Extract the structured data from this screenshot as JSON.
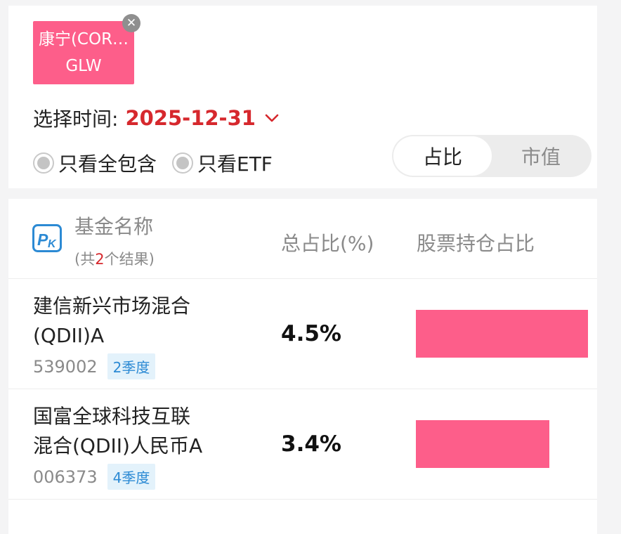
{
  "stock_tag": {
    "name": "康宁(COR…",
    "code": "GLW",
    "close_glyph": "✕"
  },
  "time_select": {
    "label": "选择时间:",
    "value": "2025-12-31"
  },
  "filters": [
    {
      "label": "只看全包含"
    },
    {
      "label": "只看ETF"
    }
  ],
  "segment": {
    "active": "占比",
    "inactive": "市值"
  },
  "table": {
    "icon": "pk-icon",
    "col_name": "基金名称",
    "count_prefix": "(共",
    "count_num": "2",
    "count_suffix": "个结果)",
    "col_total": "总占比(%)",
    "col_stock": "股票持仓占比",
    "rows": [
      {
        "name_line1": "建信新兴市场混合",
        "name_line2": "(QDII)A",
        "code": "539002",
        "quarter": "2季度",
        "total_pct": "4.5%",
        "stock_ratio": 1.0
      },
      {
        "name_line1": "国富全球科技互联",
        "name_line2": "混合(QDII)人民币A",
        "code": "006373",
        "quarter": "4季度",
        "total_pct": "3.4%",
        "stock_ratio": 0.775
      }
    ]
  },
  "colors": {
    "accent_pink": "#fd5e8a",
    "date_red": "#d6282d",
    "badge_blue": "#2c8ad4",
    "badge_bg": "#e3f2fb"
  }
}
